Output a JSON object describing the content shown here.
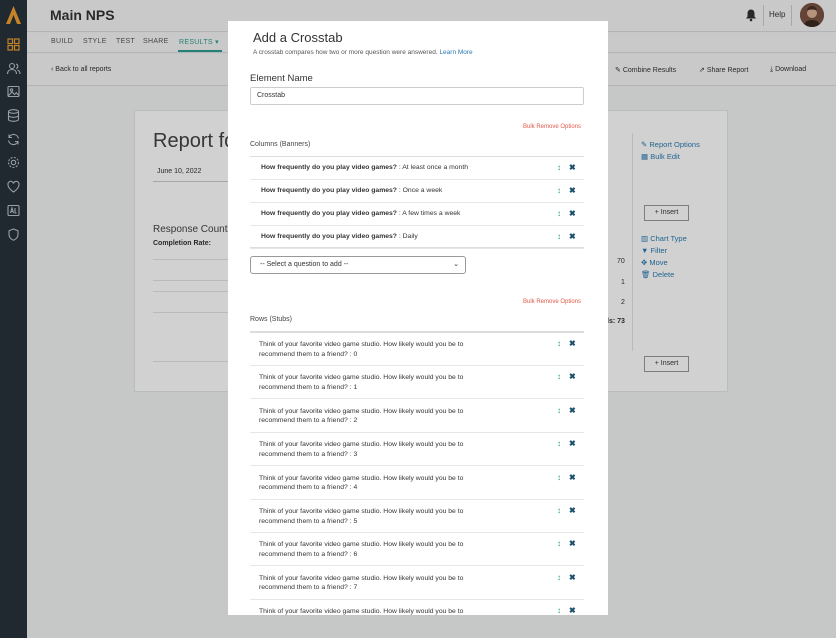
{
  "app": {
    "title": "Main NPS"
  },
  "header": {
    "help_label": "Help"
  },
  "subnav": {
    "build": "BUILD",
    "style": "STYLE",
    "test": "TEST",
    "share": "SHARE",
    "results": "RESULTS ▾"
  },
  "toolbar": {
    "back": "‹ Back to all reports",
    "combine": "Combine Results",
    "share_report": "Share Report",
    "download": "Download"
  },
  "report": {
    "title": "Report fo",
    "date": "June 10, 2022",
    "response_counts": "Response Counts",
    "completion_rate": "Completion Rate:",
    "num_70": "70",
    "num_1": "1",
    "num_2": "2",
    "total_label": "ls: 73",
    "report_options": "Report Options",
    "bulk_edit": "Bulk Edit",
    "insert_label": "+ Insert",
    "chart_type": "Chart Type",
    "filter": "Filter",
    "move": "Move",
    "delete": "Delete"
  },
  "modal": {
    "title": "Add a Crosstab",
    "description": "A crosstab compares how two or more question were answered.",
    "learn_more": "Learn More",
    "element_name_label": "Element Name",
    "element_name_value": "Crosstab",
    "bulk_remove": "Bulk Remove Options",
    "columns_label": "Columns (Banners)",
    "rows_label": "Rows (Stubs)",
    "select_placeholder": "-- Select a question to add --",
    "columns": [
      {
        "question": "How frequently do you play video games?",
        "answer": " : At least once a month"
      },
      {
        "question": "How frequently do you play video games?",
        "answer": " : Once a week"
      },
      {
        "question": "How frequently do you play video games?",
        "answer": " : A few times a week"
      },
      {
        "question": "How frequently do you play video games?",
        "answer": " : Daily"
      }
    ],
    "rows": [
      {
        "text": "Think of your favorite video game studio. How likely would you be to recommend them to a friend? : 0"
      },
      {
        "text": "Think of your favorite video game studio. How likely would you be to recommend them to a friend? : 1"
      },
      {
        "text": "Think of your favorite video game studio. How likely would you be to recommend them to a friend? : 2"
      },
      {
        "text": "Think of your favorite video game studio. How likely would you be to recommend them to a friend? : 3"
      },
      {
        "text": "Think of your favorite video game studio. How likely would you be to recommend them to a friend? : 4"
      },
      {
        "text": "Think of your favorite video game studio. How likely would you be to recommend them to a friend? : 5"
      },
      {
        "text": "Think of your favorite video game studio. How likely would you be to recommend them to a friend? : 6"
      },
      {
        "text": "Think of your favorite video game studio. How likely would you be to recommend them to a friend? : 7"
      },
      {
        "text": "Think of your favorite video game studio. How likely would you be to"
      }
    ]
  },
  "colors": {
    "accent": "#2a9d8f",
    "link": "#2a7ab0",
    "danger": "#e05a4a",
    "rail": "#27323a"
  }
}
